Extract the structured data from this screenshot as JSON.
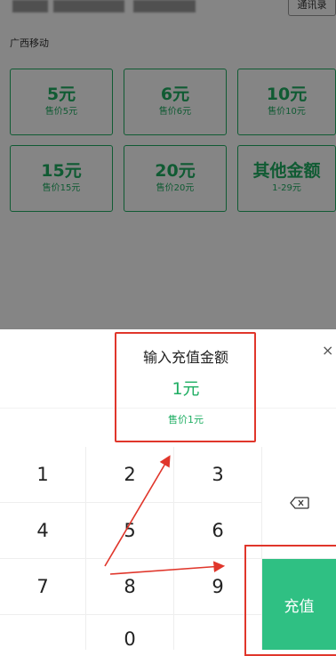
{
  "background": {
    "contacts_label": "通讯录",
    "carrier": "广西移动",
    "tiles": [
      {
        "amount": "5元",
        "price": "售价5元"
      },
      {
        "amount": "6元",
        "price": "售价6元"
      },
      {
        "amount": "10元",
        "price": "售价10元"
      },
      {
        "amount": "15元",
        "price": "售价15元"
      },
      {
        "amount": "20元",
        "price": "售价20元"
      },
      {
        "amount": "其他金额",
        "price": "1-29元"
      }
    ]
  },
  "dialog": {
    "close_glyph": "×",
    "title": "输入充值金额",
    "amount": "1元",
    "price": "售价1元"
  },
  "keypad": {
    "keys": [
      "1",
      "2",
      "3",
      "4",
      "5",
      "6",
      "7",
      "8",
      "9",
      "0"
    ],
    "backspace_icon": "backspace-icon",
    "submit_label": "充值"
  },
  "colors": {
    "accent": "#1fae63",
    "button": "#2fc083",
    "annotation": "#e0362b"
  }
}
